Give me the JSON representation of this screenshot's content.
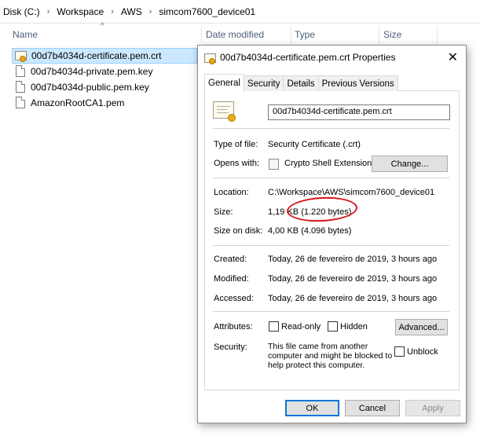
{
  "breadcrumb": [
    "Disk (C:)",
    "Workspace",
    "AWS",
    "simcom7600_device01"
  ],
  "columns": {
    "name": "Name",
    "date_modified": "Date modified",
    "type": "Type",
    "size": "Size"
  },
  "files": [
    {
      "name": "00d7b4034d-certificate.pem.crt",
      "icon": "certificate-icon",
      "selected": true
    },
    {
      "name": "00d7b4034d-private.pem.key",
      "icon": "document-icon",
      "selected": false
    },
    {
      "name": "00d7b4034d-public.pem.key",
      "icon": "document-icon",
      "selected": false
    },
    {
      "name": "AmazonRootCA1.pem",
      "icon": "document-icon",
      "selected": false
    }
  ],
  "dialog": {
    "title": "00d7b4034d-certificate.pem.crt Properties",
    "close_glyph": "✕",
    "tabs": [
      "General",
      "Security",
      "Details",
      "Previous Versions"
    ],
    "file_name": "00d7b4034d-certificate.pem.crt",
    "type_label": "Type of file:",
    "type_value": "Security Certificate (.crt)",
    "opens_label": "Opens with:",
    "opens_value": "Crypto Shell Extensions",
    "change_button": "Change...",
    "location_label": "Location:",
    "location_value": "C:\\Workspace\\AWS\\simcom7600_device01",
    "size_label": "Size:",
    "size_value": "1,19 KB (1.220 bytes)",
    "size_on_disk_label": "Size on disk:",
    "size_on_disk_value": "4,00 KB (4.096 bytes)",
    "created_label": "Created:",
    "created_value": "Today, 26 de fevereiro de 2019, 3 hours ago",
    "modified_label": "Modified:",
    "modified_value": "Today, 26 de fevereiro de 2019, 3 hours ago",
    "accessed_label": "Accessed:",
    "accessed_value": "Today, 26 de fevereiro de 2019, 3 hours ago",
    "attributes_label": "Attributes:",
    "readonly_label": "Read-only",
    "hidden_label": "Hidden",
    "advanced_button": "Advanced...",
    "security_label": "Security:",
    "security_text": "This file came from another computer and might be blocked to help protect this computer.",
    "unblock_label": "Unblock",
    "ok_button": "OK",
    "cancel_button": "Cancel",
    "apply_button": "Apply"
  },
  "colors": {
    "selection": "#cce8ff",
    "annotation": "#d6141a",
    "ok_border": "#0078d7"
  }
}
